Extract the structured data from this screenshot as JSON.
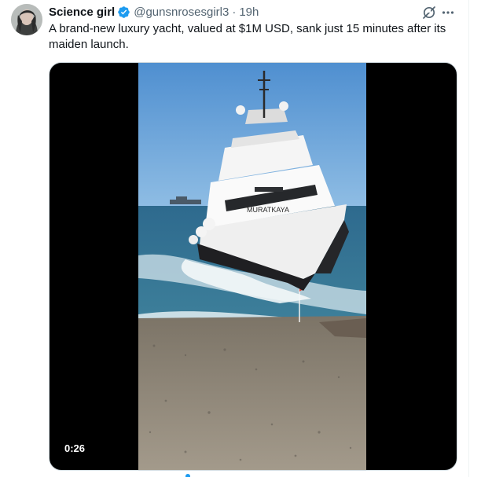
{
  "tweet": {
    "display_name": "Science girl",
    "handle": "@gunsnrosesgirl3",
    "separator": "·",
    "timestamp": "19h",
    "text": "A brand-new luxury yacht, valued at $1M USD, sank just 15 minutes after its maiden launch.",
    "verified_color": "#1d9bf0"
  },
  "media": {
    "type": "video",
    "duration_label": "0:26",
    "hull_lettering": "MURATKAYA"
  },
  "icons": {
    "verified": "verified-badge-icon",
    "grok": "grok-icon",
    "more": "more-options-icon"
  }
}
